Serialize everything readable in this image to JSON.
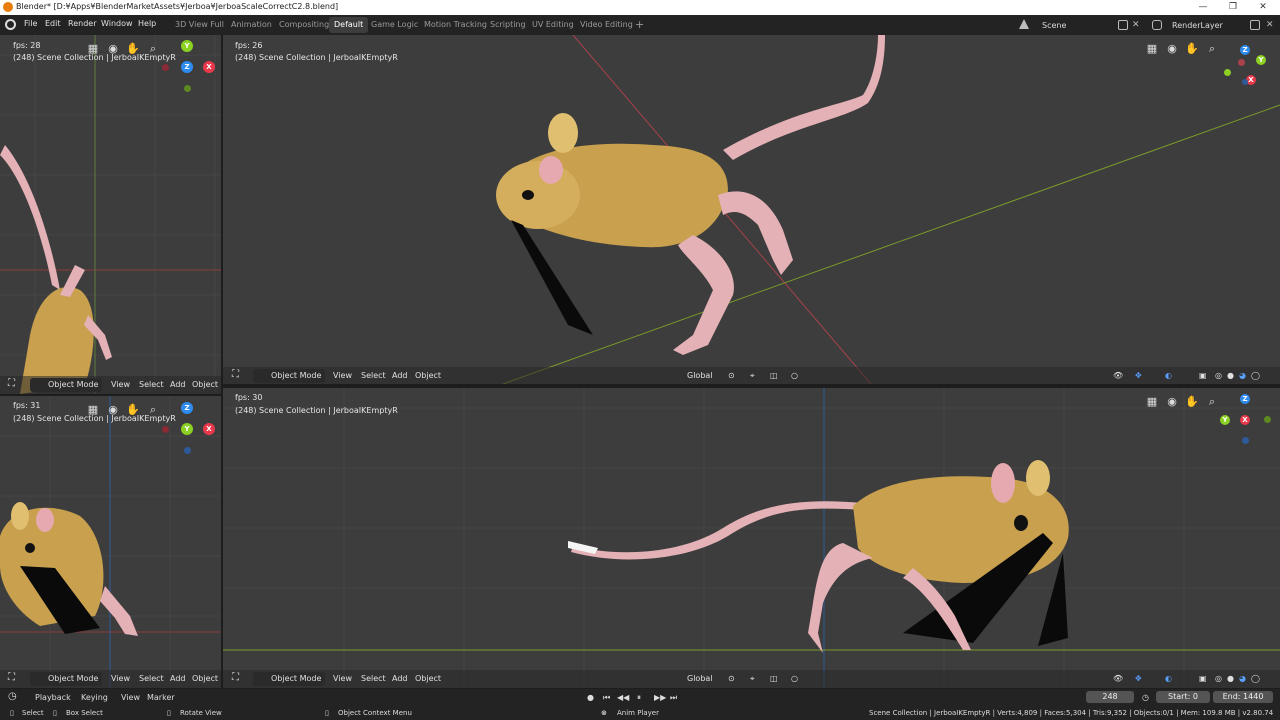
{
  "window": {
    "title": "Blender* [D:¥Apps¥BlenderMarketAssets¥Jerboa¥JerboaScaleCorrectC2.8.blend]",
    "minimize": "—",
    "restore": "❐",
    "close": "✕"
  },
  "menu": [
    "File",
    "Edit",
    "Render",
    "Window",
    "Help"
  ],
  "workspaces": [
    "3D View Full",
    "Animation",
    "Compositing",
    "Default",
    "Game Logic",
    "Motion Tracking",
    "Scripting",
    "UV Editing",
    "Video Editing"
  ],
  "active_workspace": "Default",
  "add_workspace": "+",
  "scene": {
    "label": "Scene"
  },
  "view_layer": {
    "label": "RenderLayer"
  },
  "viewports": {
    "top_left": {
      "fps": "fps: 28",
      "info": "(248) Scene Collection | JerboaIKEmptyR"
    },
    "top_right": {
      "fps": "fps: 26",
      "info": "(248) Scene Collection | JerboaIKEmptyR"
    },
    "bottom_left": {
      "fps": "fps: 31",
      "info": "(248) Scene Collection | JerboaIKEmptyR"
    },
    "bottom_right": {
      "fps": "fps: 30",
      "info": "(248) Scene Collection | JerboaIKEmptyR"
    }
  },
  "viewport_header": {
    "mode": "Object Mode",
    "view": "View",
    "select": "Select",
    "add": "Add",
    "object": "Object",
    "orientation": "Global"
  },
  "axes": {
    "x": "X",
    "y": "Y",
    "z": "Z"
  },
  "timeline": {
    "playback": "Playback",
    "keying": "Keying",
    "view": "View",
    "marker": "Marker",
    "current_frame": "248",
    "start_label": "Start:",
    "start": "0",
    "end_label": "End:",
    "end": "1440"
  },
  "status": {
    "select": "Select",
    "box_select": "Box Select",
    "rotate_view": "Rotate View",
    "context_menu": "Object Context Menu",
    "anim_player": "Anim Player",
    "stats": "Scene Collection | JerboaIKEmptyR | Verts:4,809 | Faces:5,304 | Tris:9,352 | Objects:0/1 | Mem: 109.8 MB | v2.80.74"
  },
  "colors": {
    "viewport_bg": "#3d3d3d",
    "axis_x": "#e8394a",
    "axis_y": "#8bd023",
    "axis_z": "#2e8cf0",
    "fur": "#c8a04e",
    "skin": "#e3b1b6"
  }
}
